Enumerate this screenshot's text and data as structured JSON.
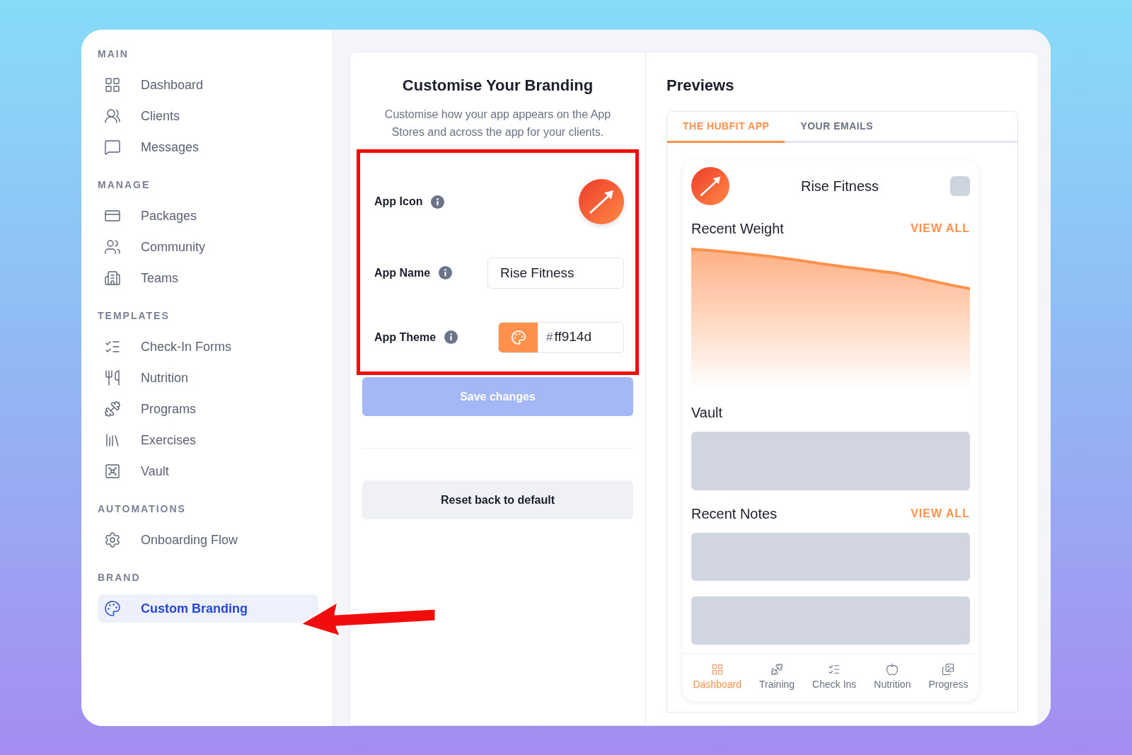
{
  "sidebar": {
    "sections": [
      {
        "title": "MAIN",
        "items": [
          {
            "label": "Dashboard",
            "selected": false
          },
          {
            "label": "Clients",
            "selected": false
          },
          {
            "label": "Messages",
            "selected": false
          }
        ]
      },
      {
        "title": "MANAGE",
        "items": [
          {
            "label": "Packages",
            "selected": false
          },
          {
            "label": "Community",
            "selected": false
          },
          {
            "label": "Teams",
            "selected": false
          }
        ]
      },
      {
        "title": "TEMPLATES",
        "items": [
          {
            "label": "Check-In Forms",
            "selected": false
          },
          {
            "label": "Nutrition",
            "selected": false
          },
          {
            "label": "Programs",
            "selected": false
          },
          {
            "label": "Exercises",
            "selected": false
          },
          {
            "label": "Vault",
            "selected": false
          }
        ]
      },
      {
        "title": "AUTOMATIONS",
        "items": [
          {
            "label": "Onboarding Flow",
            "selected": false
          }
        ]
      },
      {
        "title": "BRAND",
        "items": [
          {
            "label": "Custom Branding",
            "selected": true
          }
        ]
      }
    ]
  },
  "branding": {
    "title": "Customise Your Branding",
    "description": "Customise how your app appears on the App Stores and across the app for your clients.",
    "fields": [
      {
        "kind": "icon",
        "label": "App Icon"
      },
      {
        "kind": "text",
        "label": "App Name",
        "value": "Rise Fitness"
      },
      {
        "kind": "color",
        "label": "App Theme",
        "prefix": "#",
        "value": "ff914d"
      }
    ],
    "save_button": {
      "label": "Save changes",
      "disabled": true
    },
    "reset_button": {
      "label": "Reset back to default"
    }
  },
  "previews": {
    "title": "Previews",
    "tabs": [
      {
        "label": "THE HUBFIT APP",
        "selected": true
      },
      {
        "label": "YOUR EMAILS",
        "selected": false
      }
    ],
    "app": {
      "name": "Rise Fitness",
      "sections": [
        {
          "kind": "chart",
          "title": "Recent Weight",
          "link": "VIEW ALL"
        },
        {
          "kind": "single_block",
          "title": "Vault"
        },
        {
          "kind": "double_block",
          "title": "Recent Notes",
          "link": "VIEW ALL"
        }
      ],
      "nav": [
        {
          "label": "Dashboard",
          "selected": true
        },
        {
          "label": "Training",
          "selected": false
        },
        {
          "label": "Check Ins",
          "selected": false
        },
        {
          "label": "Nutrition",
          "selected": false
        },
        {
          "label": "Progress",
          "selected": false
        }
      ]
    }
  }
}
